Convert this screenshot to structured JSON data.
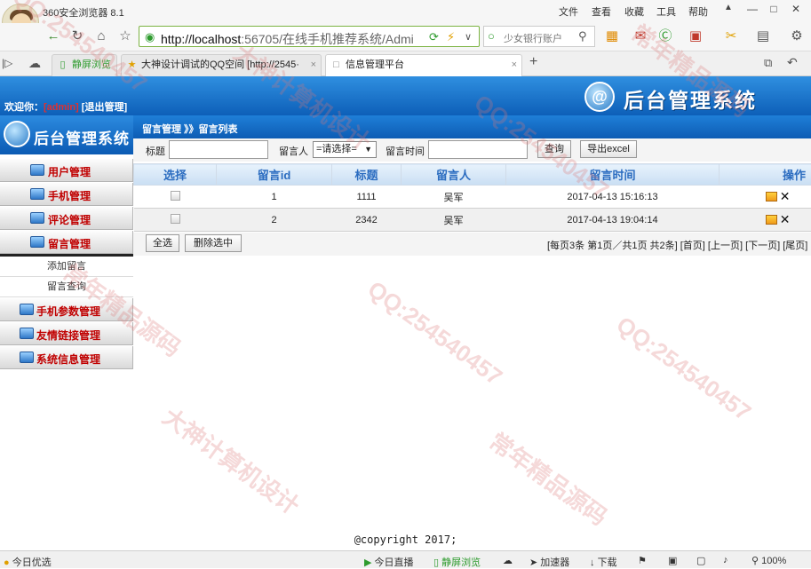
{
  "browser": {
    "name": "360安全浏览器 8.1",
    "menu": [
      "文件",
      "查看",
      "收藏",
      "工具",
      "帮助"
    ],
    "url_host": "http://localhost",
    "url_rest": ":56705/在线手机推荐系统/Admi",
    "search_placeholder": "少女银行账户",
    "tabs": [
      {
        "label": "静屏浏览",
        "active": false
      },
      {
        "label": "大神设计调试的QQ空间 [http://2545·",
        "active": false
      },
      {
        "label": "信息管理平台",
        "active": true
      }
    ],
    "new_tab": "+",
    "tab_close": "×"
  },
  "header": {
    "welcome_prefix": "欢迎你：",
    "username": "[admin]",
    "logout": "[退出管理]",
    "brand_title": "后台管理系统"
  },
  "sidebar": {
    "title": "后台管理系统",
    "items": [
      {
        "label": "用户管理"
      },
      {
        "label": "手机管理"
      },
      {
        "label": "评论管理"
      },
      {
        "label": "留言管理"
      }
    ],
    "subitems": [
      {
        "label": "添加留言"
      },
      {
        "label": "留言查询"
      }
    ],
    "items2": [
      {
        "label": "手机参数管理"
      },
      {
        "label": "友情链接管理"
      },
      {
        "label": "系统信息管理"
      }
    ]
  },
  "breadcrumb": "留言管理 》》留言列表",
  "filter": {
    "title_label": "标题",
    "author_label": "留言人",
    "select_value": "=请选择=",
    "time_label": "留言时间",
    "query_button": "查询",
    "export_button": "导出excel"
  },
  "table": {
    "headers": [
      "选择",
      "留言id",
      "标题",
      "留言人",
      "留言时间",
      "操作"
    ],
    "rows": [
      {
        "id": "1",
        "title": "1111",
        "author": "吴军",
        "time": "2017-04-13 15:16:13"
      },
      {
        "id": "2",
        "title": "2342",
        "author": "吴军",
        "time": "2017-04-13 19:04:14"
      }
    ]
  },
  "actions": {
    "select_all": "全选",
    "delete_selected": "删除选中",
    "pager": "[每页3条 第1页／共1页 共2条] [首页] [上一页] [下一页] [尾页]"
  },
  "footer": "@copyright 2017;",
  "statusbar": {
    "left": "今日优选",
    "live": "今日直播",
    "mode": "静屏浏览",
    "accelerator": "加速器",
    "download": "下载",
    "zoom": "100%"
  },
  "watermark": [
    "QQ:254540457",
    "大神计算机设计",
    "常年精品源码"
  ]
}
